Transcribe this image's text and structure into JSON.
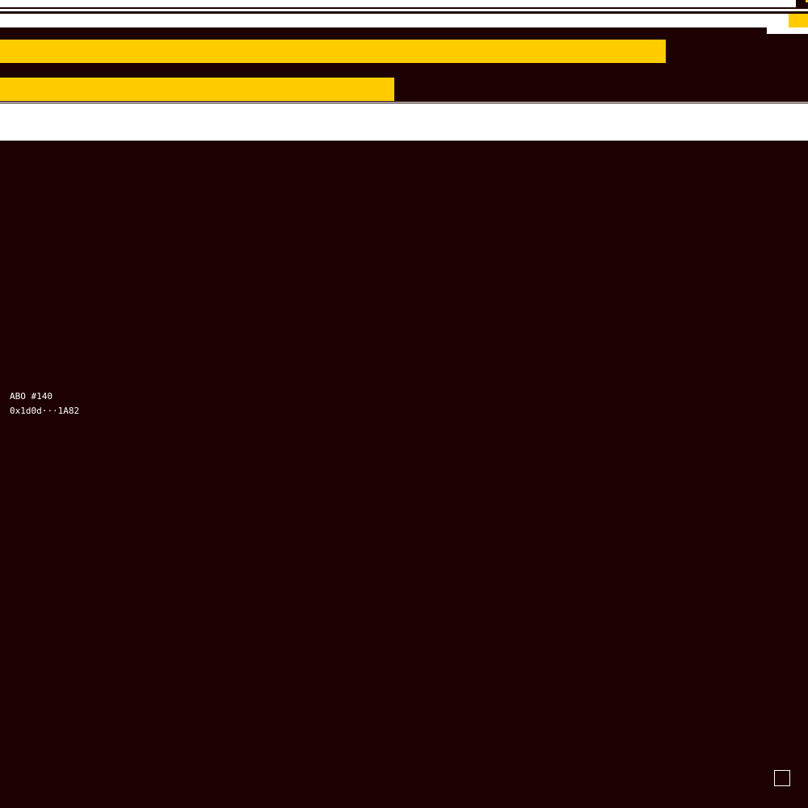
{
  "colors": {
    "background": "#1d0000",
    "white": "#ffffff",
    "yellow": "#ffcc00"
  },
  "label": {
    "title": "ABO #140",
    "address": "0x1d0d···1A82"
  },
  "corner_button_icon": "square-outline-icon"
}
